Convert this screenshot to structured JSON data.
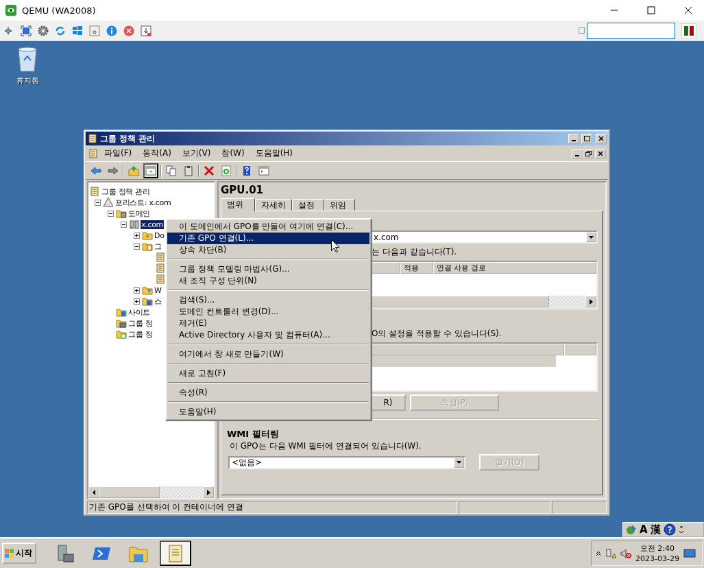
{
  "host_window": {
    "title": "QEMU (WA2008)",
    "checkbox": {
      "checked": false
    },
    "toolbar": [
      {
        "kind": "network"
      },
      {
        "kind": "fullscreen"
      },
      {
        "kind": "settings"
      },
      {
        "kind": "refresh"
      },
      {
        "kind": "windows"
      },
      {
        "kind": "keyboard"
      },
      {
        "kind": "info"
      },
      {
        "kind": "stop"
      },
      {
        "kind": "download"
      }
    ]
  },
  "desktop": {
    "icons": [
      {
        "label": "휴지통"
      }
    ]
  },
  "mmc": {
    "title": "그룹 정책 관리",
    "menu": [
      "파일(F)",
      "동작(A)",
      "보기(V)",
      "창(W)",
      "도움말(H)"
    ],
    "toolbar": [
      {
        "kind": "back",
        "pressed": false
      },
      {
        "kind": "forward",
        "pressed": false
      },
      {
        "kind": "sep"
      },
      {
        "kind": "up",
        "pressed": false
      },
      {
        "kind": "tree",
        "pressed": true
      },
      {
        "kind": "sep"
      },
      {
        "kind": "copy",
        "pressed": false
      },
      {
        "kind": "paste",
        "pressed": false
      },
      {
        "kind": "sep"
      },
      {
        "kind": "delete",
        "pressed": false
      },
      {
        "kind": "refresh",
        "pressed": false
      },
      {
        "kind": "sep"
      },
      {
        "kind": "help",
        "pressed": false
      },
      {
        "kind": "view",
        "pressed": false
      }
    ],
    "tree": [
      {
        "kind": "console",
        "label": "그룹 정책 관리",
        "selected": false,
        "children": [
          {
            "kind": "forest",
            "label": "포리스트: x.com",
            "expanded": true,
            "selected": false,
            "children": [
              {
                "kind": "domains",
                "label": "도메인",
                "expanded": true,
                "selected": false,
                "children": [
                  {
                    "kind": "domain",
                    "label": "x.com",
                    "expanded": true,
                    "selected": true,
                    "children": [
                      {
                        "kind": "ou",
                        "label": "Do",
                        "expanded": false,
                        "selected": false
                      },
                      {
                        "kind": "gpos",
                        "label": "그",
                        "expanded": true,
                        "selected": false,
                        "children": [
                          {
                            "kind": "gpo"
                          },
                          {
                            "kind": "gpo"
                          },
                          {
                            "kind": "gpo"
                          }
                        ]
                      },
                      {
                        "kind": "wmi",
                        "label": "W",
                        "expanded": false,
                        "selected": false
                      },
                      {
                        "kind": "starter",
                        "label": "스",
                        "expanded": false,
                        "selected": false
                      }
                    ]
                  }
                ]
              },
              {
                "kind": "sites",
                "label": "사이트",
                "selected": false
              },
              {
                "kind": "modeling",
                "label": "그룹 정",
                "selected": false
              },
              {
                "kind": "results",
                "label": "그룹 정",
                "selected": false
              }
            ]
          }
        ]
      }
    ],
    "detail": {
      "title": "GPU.01",
      "tabs": [
        {
          "label": "범위",
          "selected": true
        },
        {
          "label": "자세히",
          "selected": false
        },
        {
          "label": "설정",
          "selected": false
        },
        {
          "label": "위임",
          "selected": false
        }
      ],
      "links": {
        "location": "x.com",
        "caption": "는 다음과 같습니다(T).",
        "columns": [
          "적용",
          "연결 사용",
          "경로"
        ]
      },
      "security": {
        "caption": "O의 설정을 적용할 수 있습니다(S).",
        "buttons": [
          {
            "label": "R)",
            "disabled": false
          },
          {
            "label": "속성(P)",
            "disabled": true
          }
        ]
      },
      "wmi": {
        "heading": "WMI 필터링",
        "caption": "이 GPO는 다음 WMI 필터에 연결되어 있습니다(W).",
        "value": "<없음>",
        "button": {
          "label": "열기(O)",
          "disabled": true
        }
      }
    },
    "status_bar": "기존 GPO를 선택하여 이 컨테이너에 연결"
  },
  "context_menu": [
    {
      "kind": "item",
      "label": "이 도메인에서 GPO를 만들어 여기에 연결(C)...",
      "selected": false
    },
    {
      "kind": "item",
      "label": "기존 GPO 연결(L)...",
      "selected": true
    },
    {
      "kind": "item",
      "label": "상속 차단(B)",
      "selected": false
    },
    {
      "kind": "separator"
    },
    {
      "kind": "item",
      "label": "그룹 정책 모델링 마법사(G)...",
      "selected": false
    },
    {
      "kind": "item",
      "label": "새 조직 구성 단위(N)",
      "selected": false
    },
    {
      "kind": "separator"
    },
    {
      "kind": "item",
      "label": "검색(S)...",
      "selected": false
    },
    {
      "kind": "item",
      "label": "도메인 컨트롤러 변경(D)...",
      "selected": false
    },
    {
      "kind": "item",
      "label": "제거(E)",
      "selected": false
    },
    {
      "kind": "item",
      "label": "Active Directory 사용자 및 컴퓨터(A)...",
      "selected": false
    },
    {
      "kind": "separator"
    },
    {
      "kind": "item",
      "label": "여기에서 창 새로 만들기(W)",
      "selected": false
    },
    {
      "kind": "separator"
    },
    {
      "kind": "item",
      "label": "새로 고침(F)",
      "selected": false
    },
    {
      "kind": "separator"
    },
    {
      "kind": "item",
      "label": "속성(R)",
      "selected": false
    },
    {
      "kind": "separator"
    },
    {
      "kind": "item",
      "label": "도움말(H)",
      "selected": false
    }
  ],
  "language_bar": [
    "A",
    "漢"
  ],
  "taskbar": {
    "start": "시작",
    "apps": [
      {
        "kind": "server",
        "selected": false
      },
      {
        "kind": "shell",
        "selected": false
      },
      {
        "kind": "explorer",
        "selected": false
      },
      {
        "kind": "policy",
        "selected": true
      }
    ],
    "clock": {
      "time": "오전 2:40",
      "date": "2023-03-29"
    }
  }
}
